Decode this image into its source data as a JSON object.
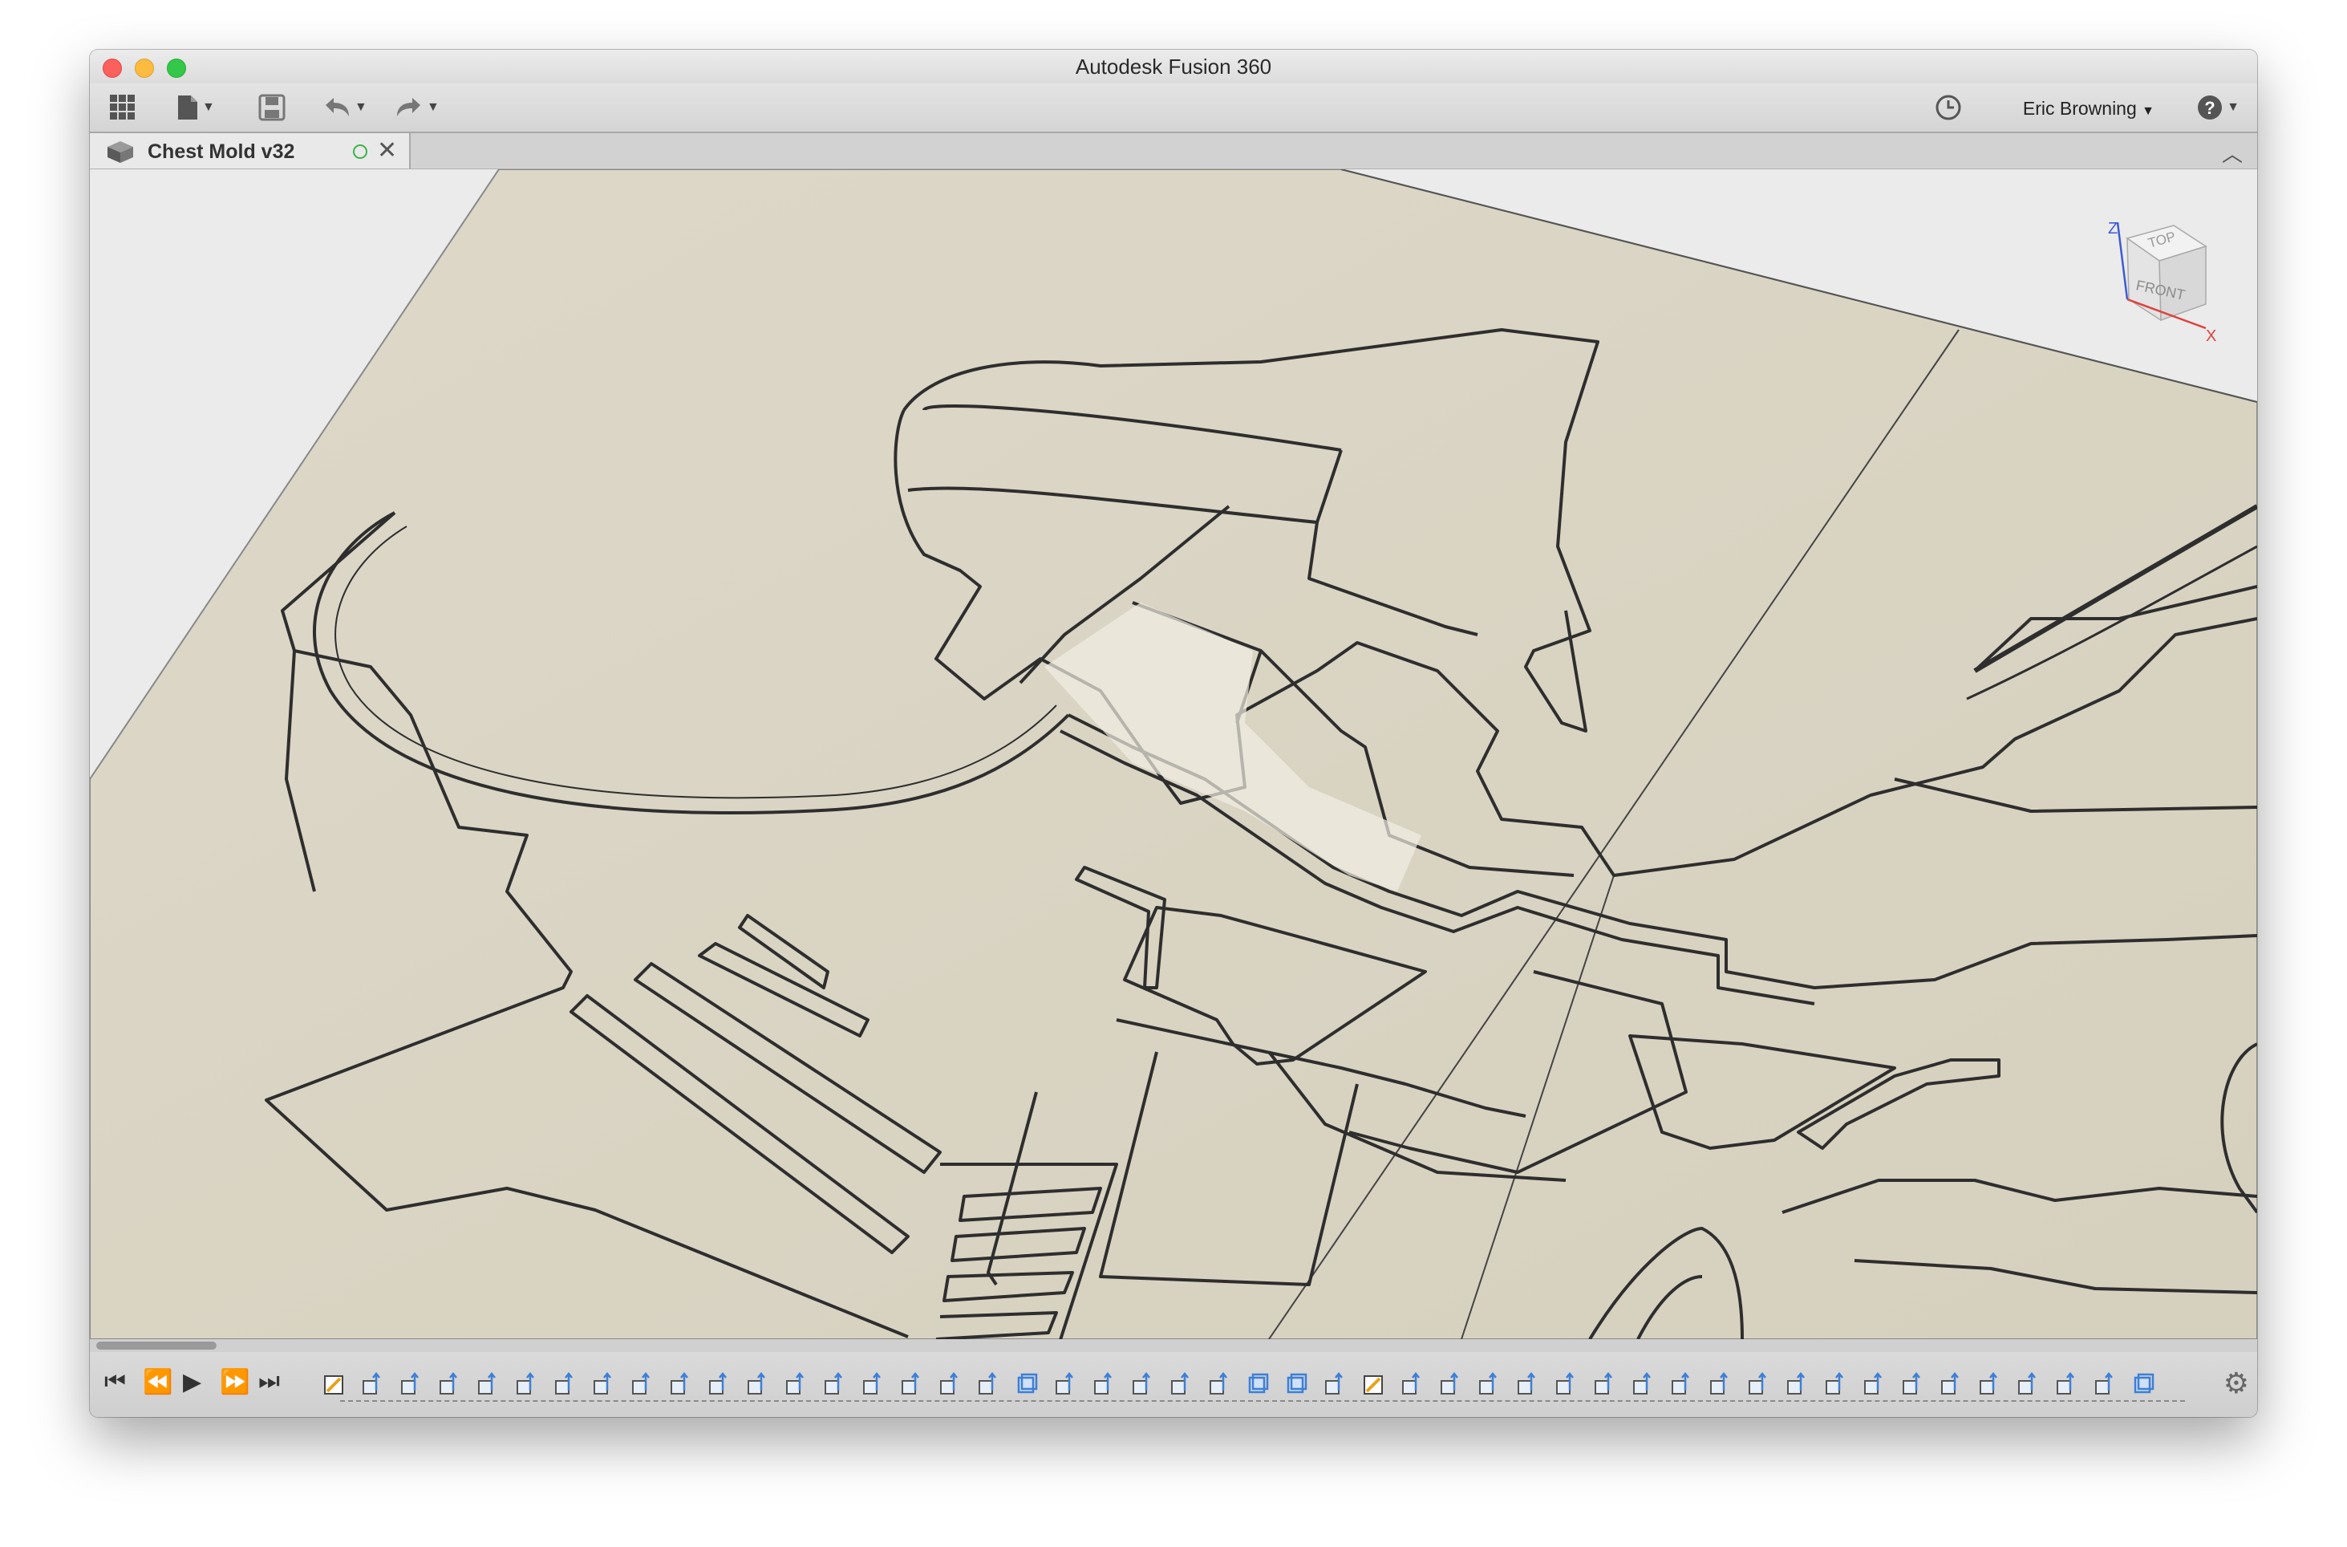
{
  "window": {
    "title": "Autodesk Fusion 360"
  },
  "toolbar": {
    "icons": [
      "apps-grid-icon",
      "file-icon",
      "save-icon",
      "undo-icon",
      "redo-icon",
      "job-status-clock-icon",
      "help-icon"
    ],
    "user_name": "Eric Browning",
    "dropdown_glyph": "▼"
  },
  "document_tab": {
    "name": "Chest Mold v32",
    "close_glyph": "✕",
    "collapse_glyph": "︿"
  },
  "viewcube": {
    "top_label": "TOP",
    "front_label": "FRONT",
    "axis_z": "Z",
    "axis_x": "X"
  },
  "timeline": {
    "controls": [
      "⏮",
      "⏪",
      "▶",
      "⏩",
      "⏭"
    ],
    "features": [
      "sketch",
      "extrude",
      "extrude",
      "extrude",
      "extrude",
      "extrude",
      "extrude",
      "extrude",
      "extrude",
      "extrude",
      "extrude",
      "extrude",
      "extrude",
      "extrude",
      "extrude",
      "extrude",
      "extrude",
      "extrude",
      "body",
      "extrude",
      "extrude",
      "extrude",
      "extrude",
      "extrude",
      "body",
      "body",
      "extrude",
      "sketch",
      "extrude",
      "extrude",
      "extrude",
      "extrude",
      "extrude",
      "extrude",
      "extrude",
      "extrude",
      "extrude",
      "extrude",
      "extrude",
      "extrude",
      "extrude",
      "extrude",
      "extrude",
      "extrude",
      "extrude",
      "extrude",
      "extrude",
      "body"
    ],
    "settings_glyph": "⚙"
  },
  "colors": {
    "plate": "#dcd6c6",
    "background": "#ebebeb",
    "edge": "#2e2e2e",
    "feature_blue": "#3d7fd6",
    "sketch_orange": "#e8a21a"
  }
}
